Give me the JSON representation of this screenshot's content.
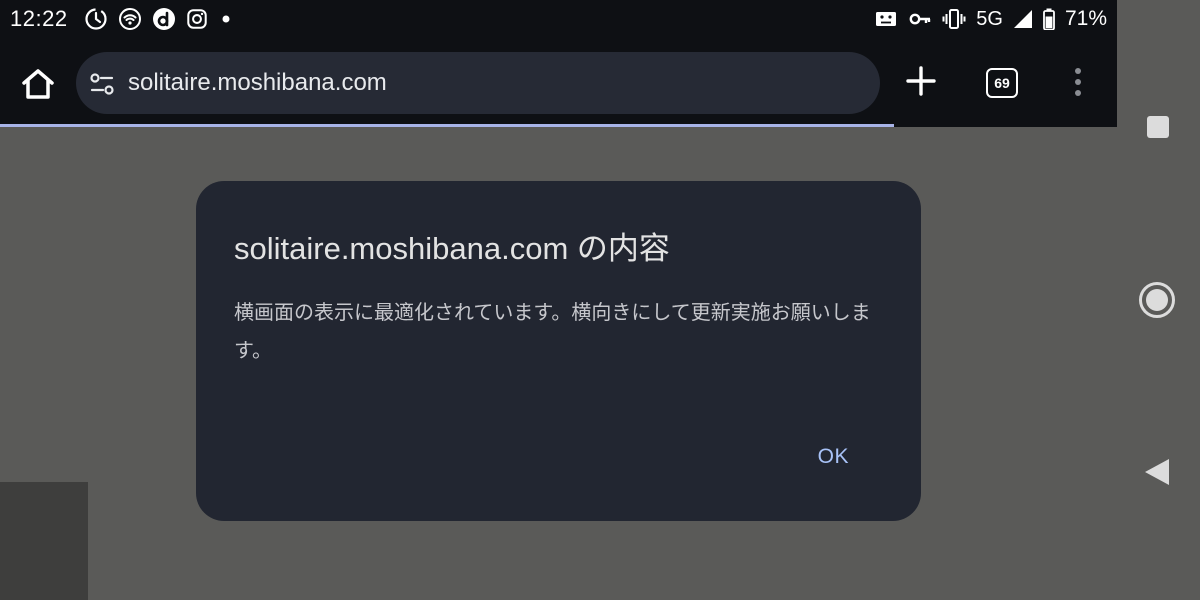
{
  "status_bar": {
    "time": "12:22",
    "left_icons": [
      "timer-icon",
      "wifi-hotspot-icon",
      "d-app-icon",
      "instagram-icon",
      "notification-dot-icon"
    ],
    "right_icons": [
      "screen-record-icon",
      "vpn-key-icon",
      "vibrate-icon",
      "signal-icon",
      "battery-icon"
    ],
    "network": "5G",
    "battery": "71%"
  },
  "browser": {
    "url": "solitaire.moshibana.com",
    "tab_count": "69",
    "load_progress": 0.8,
    "icons": {
      "home": "home-icon",
      "site_settings": "tune-icon",
      "new_tab": "plus-icon",
      "menu": "more-vert-icon"
    }
  },
  "dialog": {
    "title": "solitaire.moshibana.com の内容",
    "message": "横画面の表示に最適化されています。横向きにして更新実施お願いします。",
    "ok_label": "OK"
  },
  "nav_bar": {
    "icons": [
      "recents-icon",
      "home-circle-icon",
      "back-icon"
    ]
  },
  "colors": {
    "status_bar_bg": "#0e1014",
    "url_bar_bg": "#262a35",
    "page_bg": "#5a5a58",
    "dialog_bg": "#222631",
    "dialog_button": "#a8c2f7",
    "progress": "#a8b4e8"
  }
}
